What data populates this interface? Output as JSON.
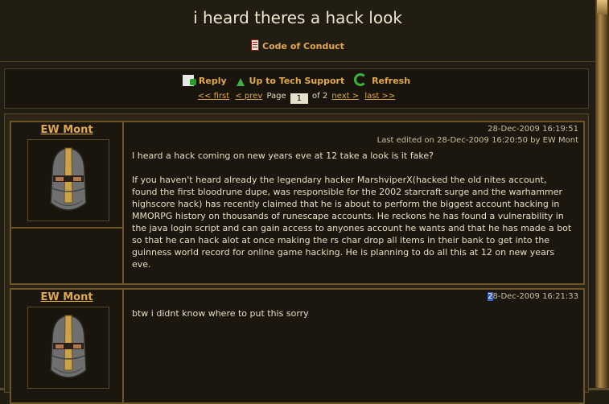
{
  "page": {
    "title": "i heard theres a hack look",
    "code_of_conduct": "Code of Conduct"
  },
  "nav": {
    "reply": "Reply",
    "up": "Up to Tech Support",
    "refresh": "Refresh",
    "first": "<< first",
    "prev": "< prev",
    "page_label": "Page",
    "current_page": "1",
    "of_pages": "of 2",
    "next": "next >",
    "last": "last >>"
  },
  "posts": [
    {
      "author": "EW Mont",
      "date": "28-Dec-2009 16:19:51",
      "edited": "Last edited on 28-Dec-2009 16:20:50 by EW Mont",
      "paragraphs": [
        "I heard a hack coming on new years eve at 12 take a look is it fake?",
        "If you haven't heard already the legendary hacker MarshviperX(hacked the old nites account, found the first bloodrune dupe, was responsible for the 2002 starcraft surge and the warhammer highscore hack) has recently claimed that he is about to perform the biggest account hacking in MMORPG history on thousands of runescape accounts. He reckons he has found a vulnerability in the java login script and can gain access to anyones account he wants and that he has made a bot so that he can hack alot at once making the rs char drop all items in their bank to get into the guinness world record for online game hacking. He is planning to do all this at 12 on new years eve."
      ]
    },
    {
      "author": "EW Mont",
      "date_highlight": "2",
      "date_rest": "8-Dec-2009 16:21:33",
      "paragraphs": [
        "btw i didnt know where to put this sorry"
      ]
    }
  ],
  "icons": [
    "document-icon",
    "reply-icon",
    "up-arrow-icon",
    "refresh-icon",
    "helmet-avatar-icon"
  ],
  "colors": {
    "background": "#221d12",
    "link": "#e0a94a",
    "border": "#6b5526",
    "text": "#e8dcc0"
  }
}
